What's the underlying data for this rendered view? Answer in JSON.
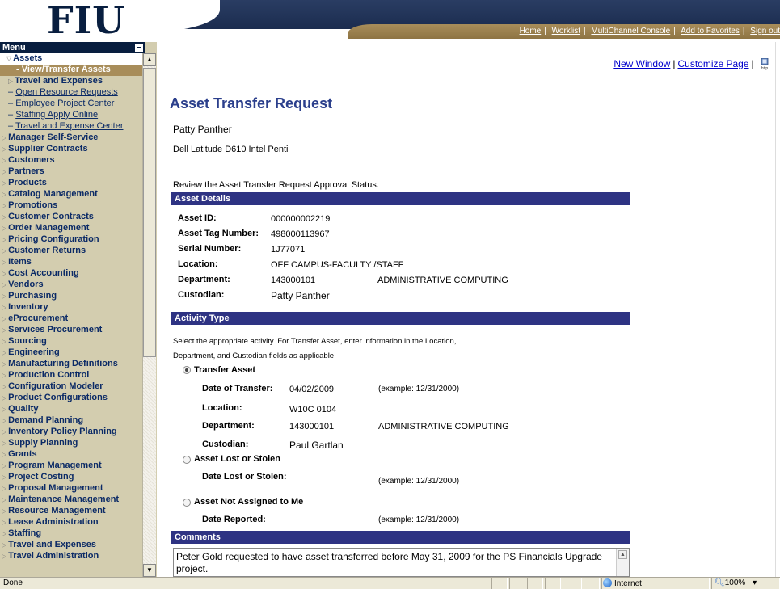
{
  "header": {
    "logo_text": "FIU",
    "links": [
      "Home",
      "Worklist",
      "MultiChannel Console",
      "Add to Favorites",
      "Sign out"
    ]
  },
  "menu": {
    "title": "Menu",
    "items": [
      {
        "label": "Assets",
        "type": "open"
      },
      {
        "label": "- View/Transfer Assets",
        "type": "selected"
      },
      {
        "label": "Travel and Expenses",
        "type": "folder-sub"
      },
      {
        "label": "Open Resource Requests",
        "type": "link"
      },
      {
        "label": "Employee Project Center",
        "type": "link"
      },
      {
        "label": "Staffing Apply Online",
        "type": "link"
      },
      {
        "label": "Travel and Expense Center",
        "type": "link"
      },
      {
        "label": "Manager Self-Service",
        "type": "folder"
      },
      {
        "label": "Supplier Contracts",
        "type": "folder"
      },
      {
        "label": "Customers",
        "type": "folder"
      },
      {
        "label": "Partners",
        "type": "folder"
      },
      {
        "label": "Products",
        "type": "folder"
      },
      {
        "label": "Catalog Management",
        "type": "folder"
      },
      {
        "label": "Promotions",
        "type": "folder"
      },
      {
        "label": "Customer Contracts",
        "type": "folder"
      },
      {
        "label": "Order Management",
        "type": "folder"
      },
      {
        "label": "Pricing Configuration",
        "type": "folder"
      },
      {
        "label": "Customer Returns",
        "type": "folder"
      },
      {
        "label": "Items",
        "type": "folder"
      },
      {
        "label": "Cost Accounting",
        "type": "folder"
      },
      {
        "label": "Vendors",
        "type": "folder"
      },
      {
        "label": "Purchasing",
        "type": "folder"
      },
      {
        "label": "Inventory",
        "type": "folder"
      },
      {
        "label": "eProcurement",
        "type": "folder"
      },
      {
        "label": "Services Procurement",
        "type": "folder"
      },
      {
        "label": "Sourcing",
        "type": "folder"
      },
      {
        "label": "Engineering",
        "type": "folder"
      },
      {
        "label": "Manufacturing Definitions",
        "type": "folder"
      },
      {
        "label": "Production Control",
        "type": "folder"
      },
      {
        "label": "Configuration Modeler",
        "type": "folder"
      },
      {
        "label": "Product Configurations",
        "type": "folder"
      },
      {
        "label": "Quality",
        "type": "folder"
      },
      {
        "label": "Demand Planning",
        "type": "folder"
      },
      {
        "label": "Inventory Policy Planning",
        "type": "folder"
      },
      {
        "label": "Supply Planning",
        "type": "folder"
      },
      {
        "label": "Grants",
        "type": "folder"
      },
      {
        "label": "Program Management",
        "type": "folder"
      },
      {
        "label": "Project Costing",
        "type": "folder"
      },
      {
        "label": "Proposal Management",
        "type": "folder"
      },
      {
        "label": "Maintenance Management",
        "type": "folder"
      },
      {
        "label": "Resource Management",
        "type": "folder"
      },
      {
        "label": "Lease Administration",
        "type": "folder"
      },
      {
        "label": "Staffing",
        "type": "folder"
      },
      {
        "label": "Travel and Expenses",
        "type": "folder"
      },
      {
        "label": "Travel Administration",
        "type": "folder"
      }
    ]
  },
  "content": {
    "top_links": {
      "new_window": "New Window",
      "customize_page": "Customize Page",
      "help_label": "http"
    },
    "title": "Asset Transfer Request",
    "requester": "Patty Panther",
    "asset_description": "Dell Latitude D610 Intel Penti",
    "review_text": "Review the Asset Transfer Request Approval Status.",
    "asset_details": {
      "header": "Asset Details",
      "asset_id_label": "Asset ID:",
      "asset_id": "000000002219",
      "tag_label": "Asset Tag Number:",
      "tag": "498000113967",
      "serial_label": "Serial Number:",
      "serial": "1J77071",
      "location_label": "Location:",
      "location": "OFF CAMPUS-FACULTY /STAFF",
      "department_label": "Department:",
      "department_code": "143000101",
      "department_name": "ADMINISTRATIVE COMPUTING",
      "custodian_label": "Custodian:",
      "custodian": "Patty Panther"
    },
    "activity": {
      "header": "Activity Type",
      "instruction_line1": "Select the appropriate activity. For Transfer Asset, enter information in the Location,",
      "instruction_line2": "Department, and Custodian fields as applicable.",
      "transfer_label": "Transfer Asset",
      "date_transfer_label": "Date of Transfer:",
      "date_transfer": "04/02/2009",
      "example": "(example: 12/31/2000)",
      "location_label": "Location:",
      "location": "W10C 0104",
      "department_label": "Department:",
      "department_code": "143000101",
      "department_name": "ADMINISTRATIVE COMPUTING",
      "custodian_label": "Custodian:",
      "custodian": "Paul Gartlan",
      "lost_label": "Asset Lost or Stolen",
      "date_lost_label": "Date Lost or Stolen:",
      "not_assigned_label": "Asset Not Assigned to Me",
      "date_reported_label": "Date Reported:"
    },
    "comments": {
      "header": "Comments",
      "text": "Peter Gold requested to have asset transferred before May 31, 2009 for the PS Financials Upgrade project."
    }
  },
  "status": {
    "text": "Done",
    "zone": "Internet",
    "zoom": "100%"
  }
}
